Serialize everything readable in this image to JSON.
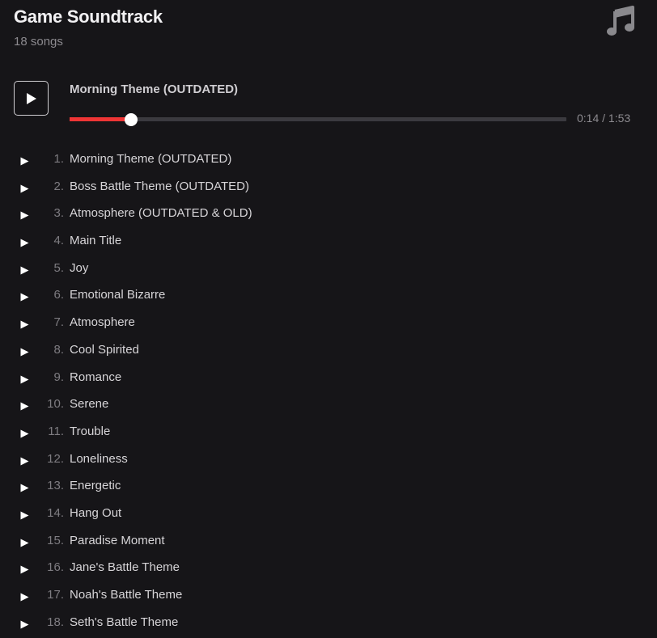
{
  "playlist": {
    "title": "Game Soundtrack",
    "song_count": "18 songs"
  },
  "player": {
    "now_playing": "Morning Theme (OUTDATED)",
    "time": "0:14 / 1:53",
    "progress": 0.124,
    "colors": {
      "progress_fill": "#ef3535",
      "track": "#3b3a3f",
      "handle": "#ffffff"
    }
  },
  "icons": {
    "header": "music-note-icon",
    "play": "play-icon"
  },
  "tracks": [
    {
      "num": "1.",
      "name": "Morning Theme (OUTDATED)"
    },
    {
      "num": "2.",
      "name": "Boss Battle Theme (OUTDATED)"
    },
    {
      "num": "3.",
      "name": "Atmosphere (OUTDATED & OLD)"
    },
    {
      "num": "4.",
      "name": "Main Title"
    },
    {
      "num": "5.",
      "name": "Joy"
    },
    {
      "num": "6.",
      "name": "Emotional Bizarre"
    },
    {
      "num": "7.",
      "name": "Atmosphere"
    },
    {
      "num": "8.",
      "name": "Cool Spirited"
    },
    {
      "num": "9.",
      "name": "Romance"
    },
    {
      "num": "10.",
      "name": "Serene"
    },
    {
      "num": "11.",
      "name": "Trouble"
    },
    {
      "num": "12.",
      "name": "Loneliness"
    },
    {
      "num": "13.",
      "name": "Energetic"
    },
    {
      "num": "14.",
      "name": "Hang Out"
    },
    {
      "num": "15.",
      "name": "Paradise Moment"
    },
    {
      "num": "16.",
      "name": "Jane's Battle Theme"
    },
    {
      "num": "17.",
      "name": "Noah's Battle Theme"
    },
    {
      "num": "18.",
      "name": "Seth's Battle Theme"
    }
  ]
}
